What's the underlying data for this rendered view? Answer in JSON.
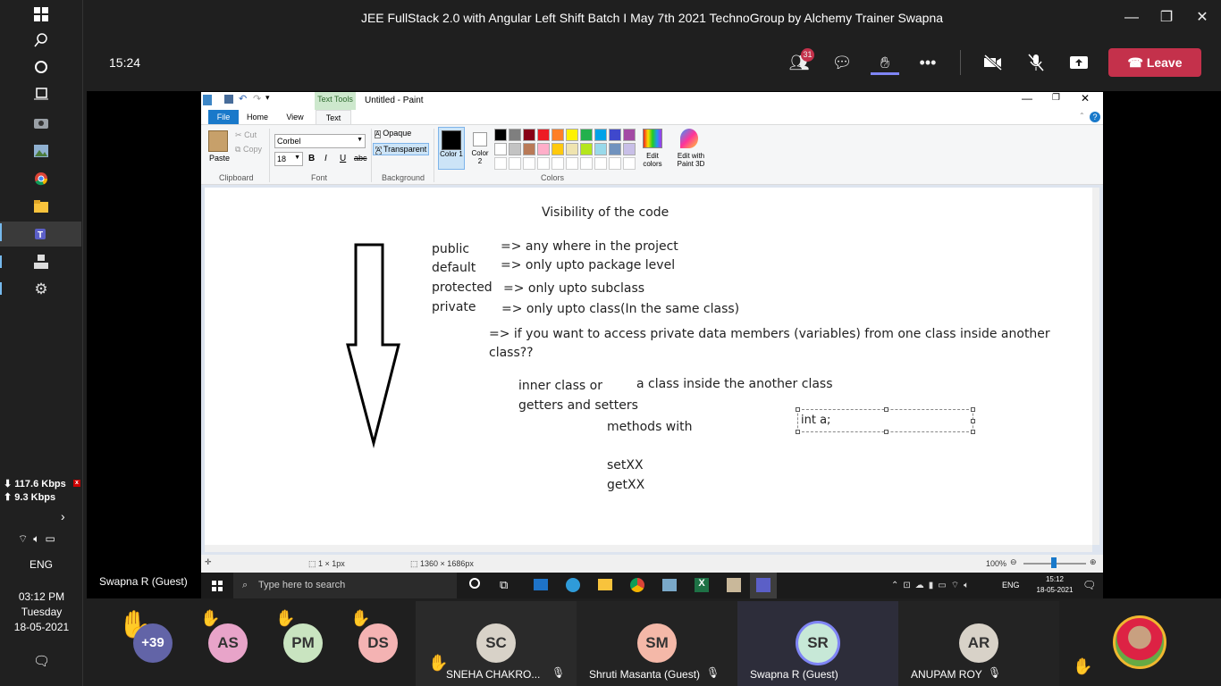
{
  "window_title": "JEE FullStack 2.0 with Angular Left Shift Batch I May 7th 2021 TechnoGroup by Alchemy Trainer Swapna",
  "meeting": {
    "timer": "15:24",
    "participants_badge": "31",
    "leave_label": "Leave",
    "presenter_label": "Swapna R (Guest)"
  },
  "system": {
    "net_down": "117.6 Kbps",
    "net_up": "9.3 Kbps",
    "lang": "ENG",
    "time": "03:12 PM",
    "day": "Tuesday",
    "date": "18-05-2021"
  },
  "paint": {
    "tools_tab": "Text Tools",
    "title": "Untitled - Paint",
    "tabs": [
      "File",
      "Home",
      "View",
      "Text"
    ],
    "clipboard": {
      "paste": "Paste",
      "cut": "Cut",
      "copy": "Copy",
      "group": "Clipboard"
    },
    "font": {
      "family": "Corbel",
      "size": "18",
      "group": "Font"
    },
    "background": {
      "opaque": "Opaque",
      "transparent": "Transparent",
      "group": "Background"
    },
    "colors": {
      "color1": "Color 1",
      "color2": "Color 2",
      "edit": "Edit colors",
      "paint3d": "Edit with Paint 3D",
      "group": "Colors"
    },
    "palette": [
      "#000000",
      "#7f7f7f",
      "#880015",
      "#ed1c24",
      "#ff7f27",
      "#fff200",
      "#22b14c",
      "#00a2e8",
      "#3f48cc",
      "#a349a4",
      "#ffffff",
      "#c3c3c3",
      "#b97a57",
      "#ffaec9",
      "#ffc90e",
      "#efe4b0",
      "#b5e61d",
      "#99d9ea",
      "#7092be",
      "#c8bfe7"
    ],
    "canvas_text": {
      "heading": "Visibility of the code",
      "public": "public",
      "default": "default",
      "protected": "protected",
      "private": "private",
      "d_public": "=> any where in the project",
      "d_default": "=> only upto package level",
      "d_protected": "=> only upto subclass",
      "d_private": "=> only upto class(In the same class)",
      "question_1": "=> if you want to access private data members (variables) from one class inside another",
      "question_2": "class??",
      "inner": "inner class or",
      "inner_desc": "a class inside the another class",
      "getset": "getters and setters",
      "methods": "methods with",
      "setxx": "setXX",
      "getxx": "getXX",
      "textbox": "int a;"
    },
    "status": {
      "size1": "1 × 1px",
      "size2": "1360 × 1686px",
      "zoom": "100%"
    },
    "taskbar": {
      "search": "Type here to search",
      "lang": "ENG",
      "time": "15:12",
      "date": "18-05-2021"
    }
  },
  "participants": [
    {
      "initials": "+39",
      "color": "#6264a7"
    },
    {
      "initials": "AS",
      "color": "#e8a4c9"
    },
    {
      "initials": "PM",
      "color": "#c9e4c0"
    },
    {
      "initials": "DS",
      "color": "#f4b3b3"
    },
    {
      "initials": "SC",
      "name": "SNEHA CHAKRO...",
      "color": "#d8d2c8"
    },
    {
      "initials": "SM",
      "name": "Shruti Masanta (Guest)",
      "color": "#f4b8a8"
    },
    {
      "initials": "SR",
      "name": "Swapna R (Guest)",
      "color": "#c7e8d7"
    },
    {
      "initials": "AR",
      "name": "ANUPAM ROY",
      "color": "#d8d2c8"
    }
  ]
}
